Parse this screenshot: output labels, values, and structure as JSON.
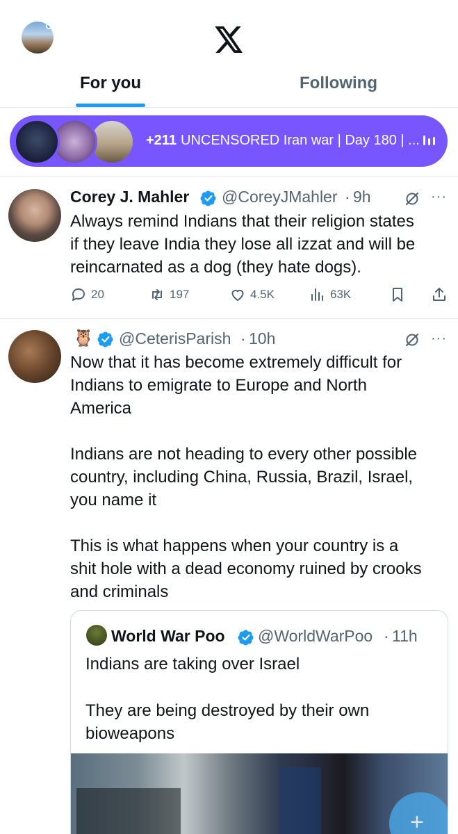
{
  "header": {
    "tabs": [
      "For you",
      "Following"
    ],
    "active_tab": "For you"
  },
  "spaces_bar": {
    "count": "+211",
    "title": "UNCENSORED Iran war | Day 180 | ..."
  },
  "tweets": [
    {
      "name": "Corey J. Mahler",
      "handle": "@CoreyJMahler",
      "time": "9h",
      "text_lines": [
        "Always remind Indians that their religion states",
        "if they leave India they lose all izzat and will be",
        "reincarnated as a dog (they hate dogs)."
      ],
      "replies": "20",
      "reposts": "197",
      "likes": "4.5K",
      "views": "63K"
    },
    {
      "name_emoji": "🦉",
      "handle": "@CeterisParish",
      "time": "10h",
      "text_lines": [
        "Now that it has become extremely difficult for",
        "Indians to emigrate to Europe and North",
        "America",
        "",
        "Indians are not heading to every other possible",
        "country, including China, Russia, Brazil, Israel,",
        "you name it",
        "",
        "This is what happens when your country is a",
        "shit hole with a dead economy ruined by crooks",
        "and criminals"
      ],
      "quote": {
        "name": "World War Poo",
        "handle": "@WorldWarPoo",
        "time": "11h",
        "text_lines": [
          "Indians are taking over Israel",
          "",
          "They are being destroyed by their own",
          "bioweapons"
        ]
      }
    }
  ],
  "colors": {
    "accent": "#1d9bf0",
    "spaces": "#7856ff",
    "secondary_text": "#536471"
  }
}
